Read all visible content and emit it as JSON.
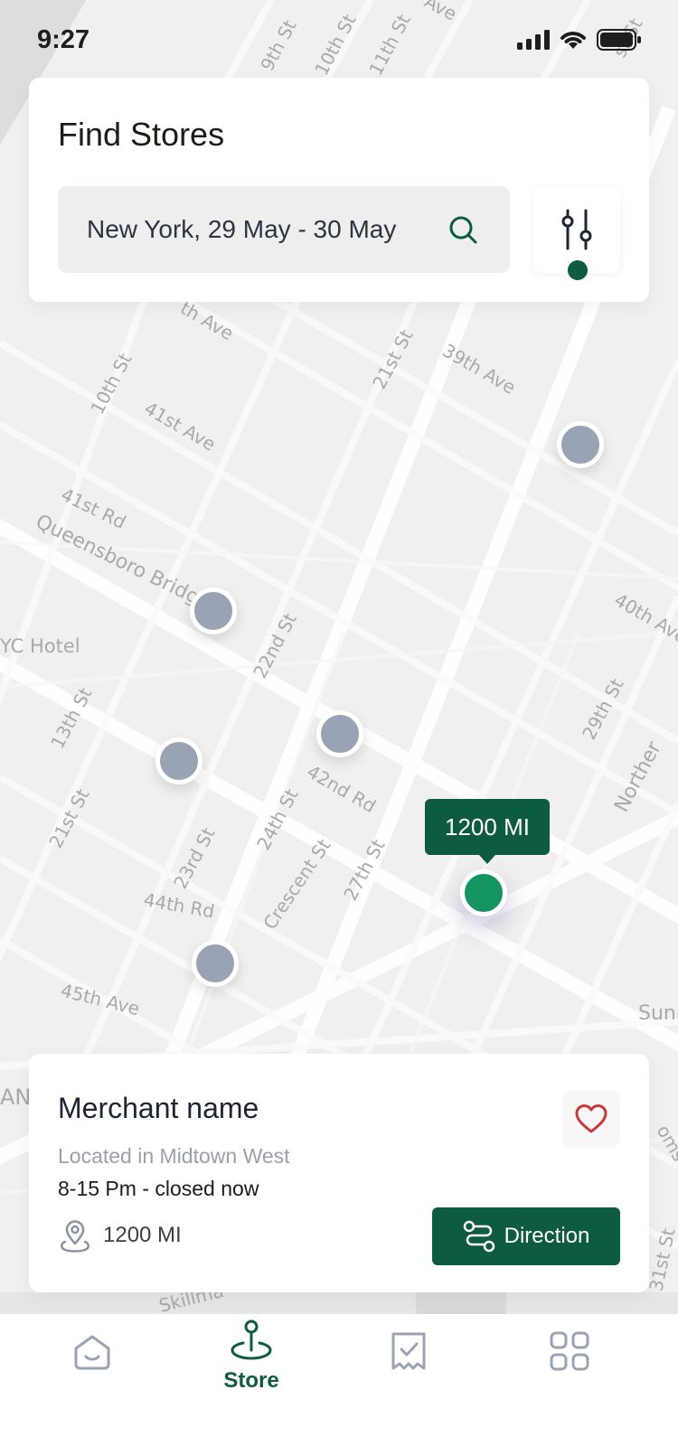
{
  "status_bar": {
    "time": "9:27"
  },
  "search_card": {
    "title": "Find Stores",
    "search_value": "New York, 29 May - 30 May"
  },
  "map": {
    "street_labels": [
      "9th St",
      "10th St",
      "11th St",
      "Ave",
      "st St",
      "th Ave",
      "21st St",
      "39th Ave",
      "10th St",
      "41st Ave",
      "41st Rd",
      "Queensboro Bridg",
      "YC Hotel",
      "22nd St",
      "40th Ave",
      "13th St",
      "42nd Rd",
      "29th St",
      "Norther",
      "21st St",
      "23rd St",
      "24th St",
      "27th St",
      "Crescent St",
      "44th Rd",
      "45th Ave",
      "Sunn",
      "AN",
      "oms",
      "31st St",
      "Skillma"
    ],
    "active_pin_distance": "1200 MI"
  },
  "merchant_card": {
    "name": "Merchant name",
    "location": "Located in Midtown West",
    "hours": "8-15 Pm - closed now",
    "distance": "1200 MI",
    "direction_label": "Direction"
  },
  "bottom_nav": {
    "items": [
      {
        "icon": "home-icon",
        "label": ""
      },
      {
        "icon": "store-location-icon",
        "label": "Store"
      },
      {
        "icon": "receipt-check-icon",
        "label": ""
      },
      {
        "icon": "grid-menu-icon",
        "label": ""
      }
    ]
  },
  "colors": {
    "brand_green": "#0d5c41",
    "active_pin": "#14945f",
    "inactive_pin": "#9aa3b5",
    "heart": "#c83a3a"
  }
}
